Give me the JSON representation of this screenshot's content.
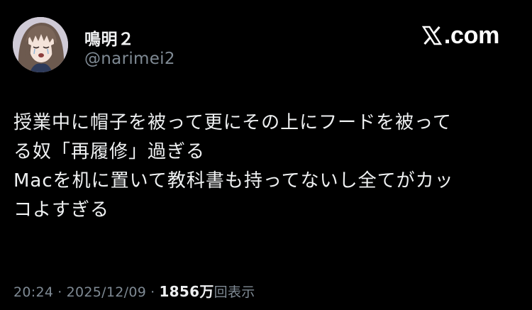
{
  "author": {
    "display_name": "鳴明２",
    "handle": "@narimei2"
  },
  "brand": {
    "icon": "x-logo-icon",
    "domain": ".com"
  },
  "tweet": {
    "lines": [
      "授業中に帽子を被って更にその上にフードを被って",
      "る奴「再履修」過ぎる",
      "Macを机に置いて教科書も持ってないし全てがカッ",
      "コよすぎる"
    ]
  },
  "meta": {
    "time": "20:24",
    "separator": "·",
    "date": "2025/12/09",
    "views_count": "1856万",
    "views_label": "回表示"
  },
  "colors": {
    "background": "#000000",
    "text": "#e7e9ea",
    "secondary": "#7f8a94"
  }
}
